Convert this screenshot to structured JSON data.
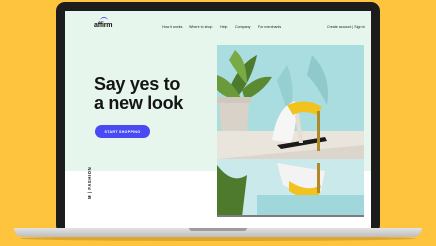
{
  "brand": {
    "logo_text": "affirm"
  },
  "nav": {
    "links": [
      "How it works",
      "Where to shop",
      "Help",
      "Company",
      "For merchants"
    ],
    "account": "Create account | Sign in"
  },
  "hero": {
    "title_line1": "Say yes to",
    "title_line2": "a new look",
    "cta_label": "START SHOPPING"
  },
  "section": {
    "vertical_label": "M | FASHION"
  },
  "colors": {
    "background": "#ffc43d",
    "accent": "#4a4af4",
    "hero_bg": "#e6f6ec"
  }
}
